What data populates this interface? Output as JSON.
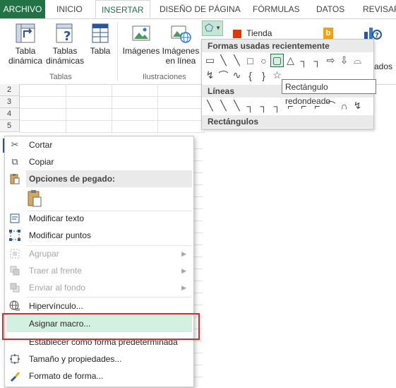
{
  "tabs": {
    "file": "ARCHIVO",
    "items": [
      "INICIO",
      "INSERTAR",
      "DISEÑO DE PÁGINA",
      "FÓRMULAS",
      "DATOS",
      "REVISAR"
    ],
    "active": "INSERTAR"
  },
  "ribbon": {
    "buttons": {
      "pivot_table": "Tabla\ndinámica",
      "recommended_pivot": "Tablas\ndinámicas",
      "table": "Tabla",
      "images": "Imágenes",
      "online_images": "Imágenes\nen línea",
      "store": "Tienda"
    },
    "groups": {
      "tables": "Tablas",
      "illustrations": "Ilustraciones"
    },
    "partial_label": "ados"
  },
  "grid": {
    "rows": [
      "2",
      "3",
      "4",
      "5"
    ]
  },
  "shapes_dropdown": {
    "recent_header": "Formas usadas recientemente",
    "lines_header": "Líneas",
    "rect_header": "Rectángulos",
    "recent_row1": [
      "▭",
      "╲",
      "╲",
      "□",
      "○",
      "▢",
      "△",
      "┐",
      "┐",
      "⇨",
      "⇩",
      "⌓"
    ],
    "recent_row2": [
      "↯",
      "⌒",
      "∿",
      "{",
      "}",
      "☆"
    ],
    "lines_row": [
      "╲",
      "╲",
      "╲",
      "┐",
      "┐",
      "┐",
      "⌐",
      "⌐",
      "⌐",
      "⌒",
      "∩",
      "↯"
    ]
  },
  "tooltip": "Rectángulo redondeado",
  "context_menu": {
    "cut": "Cortar",
    "copy": "Copiar",
    "paste_options": "Opciones de pegado:",
    "edit_text": "Modificar texto",
    "edit_points": "Modificar puntos",
    "group": "Agrupar",
    "bring_front": "Traer al frente",
    "send_back": "Enviar al fondo",
    "hyperlink": "Hipervínculo...",
    "assign_macro": "Asignar macro...",
    "set_default": "Establecer como forma predeterminada",
    "size_props": "Tamaño y propiedades...",
    "format_shape": "Formato de forma..."
  },
  "colors": {
    "accent": "#217346",
    "highlight": "#d3f0e0",
    "callout": "#e0262b"
  }
}
